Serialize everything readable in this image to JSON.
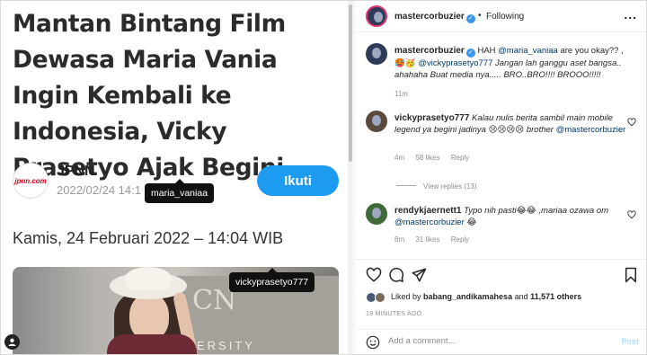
{
  "article": {
    "headline": "Mantan Bintang Film Dewasa Maria Vania Ingin Kembali ke Indonesia, Vicky Prasetyo Ajak Begini",
    "source_logo": "jpnn.com",
    "source_name": "JPNN",
    "source_date": "2022/02/24 14:1",
    "follow_label": "Ikuti",
    "publish_date": "Kamis, 24 Februari 2022 – 14:04 WIB",
    "photo_text": "CN",
    "photo_subtext": "ERSITY",
    "tags": [
      "maria_vaniaa",
      "vickyprasetyo777"
    ]
  },
  "post": {
    "header_username": "mastercorbuzier",
    "dot": "•",
    "following_label": "Following",
    "more": "...",
    "comments": [
      {
        "username": "mastercorbuzier",
        "text_before": "HAH ",
        "mention1": "@maria_vaniaa",
        "text_mid": " are you okay?? , 🥵🥳",
        "mention2": "@vickyprasetyo777",
        "text_after": " Jangan lah ganggu aset bangsa.. ahahaha Buat media nya..... BRO..BRO!!!! BROOO!!!!!",
        "time": "11m"
      },
      {
        "username": "vickyprasetyo777",
        "text": "Kalau nulis berita sambil main mobile legend ya begini jadinya 😢😢😢😢 brother",
        "mention": "@mastercorbuzier",
        "time": "4m",
        "likes": "58 likes",
        "reply": "Reply"
      },
      {
        "username": "rendykjaernett1",
        "text": "Typo nih pasti😂😂 ,mariaa ozawa om",
        "mention": "@mastercorbuzier",
        "emoji": "😂",
        "time": "8m",
        "likes": "31 likes",
        "reply": "Reply"
      }
    ],
    "view_replies": "View replies (13)",
    "liked_by_prefix": "Liked by ",
    "liked_by_user": "babang_andikamahesa",
    "liked_by_mid": " and ",
    "liked_by_count": "11,571 others",
    "time_ago": "19 MINUTES AGO",
    "add_comment_placeholder": "Add a comment...",
    "post_label": "Post"
  },
  "icons": {
    "heart": "heart-icon",
    "comment": "comment-icon",
    "share": "share-icon",
    "save": "bookmark-icon",
    "emoji": "emoji-icon",
    "user_tag": "user-tag-icon",
    "verified": "verified-badge"
  },
  "colors": {
    "follow_button": "#1d9bf0",
    "mention": "#00376b",
    "verified": "#3897f0",
    "post_disabled": "#b2dffc"
  }
}
